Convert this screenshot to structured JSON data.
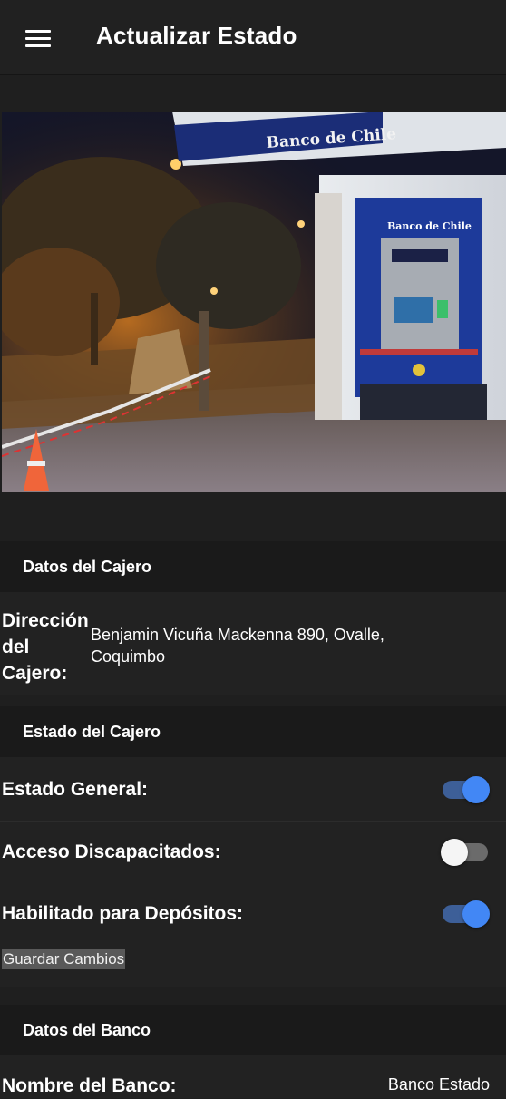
{
  "header": {
    "title": "Actualizar Estado",
    "menu_icon": "hamburger-menu-icon"
  },
  "atm_photo": {
    "sign_text": "Banco de Chile",
    "atm_brand": "Banco de Chile"
  },
  "sections": {
    "atm_data": {
      "title": "Datos del Cajero",
      "address_label_1": "Dirección",
      "address_label_2": "del",
      "address_label_3": "Cajero:",
      "address_value_1": "Benjamin Vicuña Mackenna 890, Ovalle,",
      "address_value_2": "Coquimbo"
    },
    "atm_state": {
      "title": "Estado del Cajero",
      "items": [
        {
          "label": "Estado General:",
          "on": true
        },
        {
          "label": "Acceso Discapacitados:",
          "on": false
        },
        {
          "label": "Habilitado para Depósitos:",
          "on": true
        }
      ],
      "save_label": "Guardar Cambios"
    },
    "bank_data": {
      "title": "Datos del Banco",
      "bank_name_label": "Nombre del Banco:",
      "bank_name_value": "Banco Estado"
    }
  },
  "colors": {
    "toggle_on": "#4287f5",
    "toggle_on_track": "#3d5f98",
    "toggle_off_knob": "#f5f5f5",
    "background": "#1f1f1f"
  }
}
